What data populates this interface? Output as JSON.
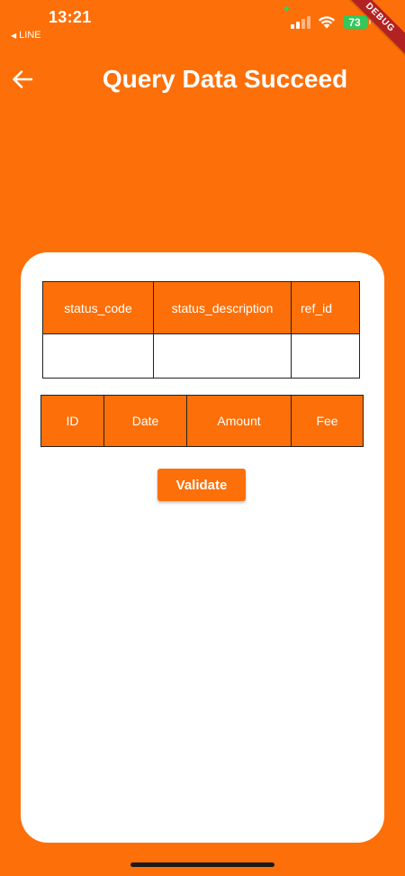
{
  "status_bar": {
    "time": "13:21",
    "back_app_label": "LINE",
    "battery_level": "73"
  },
  "debug_banner": "DEBUG",
  "app_bar": {
    "title": "Query Data Succeed"
  },
  "status_table": {
    "headers": [
      "status_code",
      "status_description",
      "ref_id"
    ],
    "row": [
      "",
      "",
      ""
    ]
  },
  "transactions_table": {
    "headers": [
      "ID",
      "Date",
      "Amount",
      "Fee"
    ]
  },
  "validate_button": "Validate",
  "colors": {
    "primary": "#FD6F08",
    "card": "#FFFFFF",
    "battery": "#34C759",
    "debug_ribbon": "#B32222"
  },
  "icons": {
    "back": "arrow-left-icon",
    "signal": "cellular-signal-icon",
    "wifi": "wifi-icon",
    "battery": "battery-icon"
  }
}
